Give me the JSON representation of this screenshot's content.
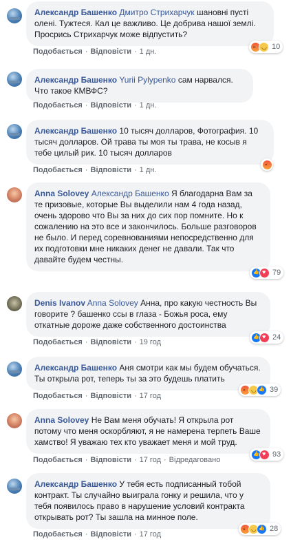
{
  "labels": {
    "like": "Подобається",
    "reply": "Відповісти",
    "edited": "Відредаговано",
    "dot": "·"
  },
  "comments": [
    {
      "author": "Александр Башенко",
      "mention": "Дмитро Стрихарчук",
      "text": "шановні пусті олені. Тужтеся. Кал це важливо. Це добрива нашої землі. Просрись Стрихарчук може відпустить?",
      "time": "1 дн.",
      "reactions": [
        "angry",
        "laugh"
      ],
      "count": "10"
    },
    {
      "author": "Александр Башенко",
      "mention": "Yurii Pylypenko",
      "text": "сам нарвался. Что такое КМВФС?",
      "time": "1 дн.",
      "reactions": [],
      "count": ""
    },
    {
      "author": "Александр Башенко",
      "mention": "",
      "text": "10 тысяч долларов, Фотография. 10 тысяч долларов. Ой трава ты моя ты трава, не косыв я тебе цилый рик. 10 тысяч долларов",
      "time": "1 дн.",
      "reactions": [
        "angry"
      ],
      "count": ""
    },
    {
      "author": "Anna Solovey",
      "mention": "Александр Башенко",
      "text": "Я благодарна Вам за те призовые, которые Вы выделили нам 4 года назад, очень здорово что Вы за них до сих пор помните. Но к сожалению на это все и закончилось. Больше разговоров не было. И перед соревнованиями непосредственно для их подготовки мне никаких денег не давали. Так что давайте будем честны.",
      "time": "",
      "reactions": [
        "like",
        "love"
      ],
      "count": "79"
    },
    {
      "author": "Denis Ivanov",
      "mention": "Anna Solovey",
      "text": "Анна, про какую честность Вы говорите ? башенко ссы в глаза - Божья роса, ему откатные дороже даже собственного достоинства",
      "time": "19 год",
      "reactions": [
        "like",
        "love"
      ],
      "count": "24"
    },
    {
      "author": "Александр Башенко",
      "mention": "",
      "text": "Аня смотри как мы будем обучаться. Ты открыла рот, теперь ты за это будешь платить",
      "time": "17 год",
      "reactions": [
        "angry",
        "laugh",
        "like"
      ],
      "count": "39"
    },
    {
      "author": "Anna Solovey",
      "mention": "",
      "text": "Не Вам меня обучать! Я открыла рот потому что меня оскорбляют, я не намерена терпеть Ваше хамство! Я уважаю тех кто уважает меня и мой труд.",
      "time": "17 год",
      "reactions": [
        "like",
        "love"
      ],
      "count": "93"
    },
    {
      "author": "Александр Башенко",
      "mention": "",
      "text": "У тебя есть подписанный тобой контракт. Ты случайно выиграла гонку и решила, что у тебя появилось право в нарушение условий контракта открывать рот? Ты зашла на минное поле.",
      "time": "17 год",
      "reactions": [
        "angry",
        "laugh",
        "like"
      ],
      "count": "28"
    }
  ]
}
